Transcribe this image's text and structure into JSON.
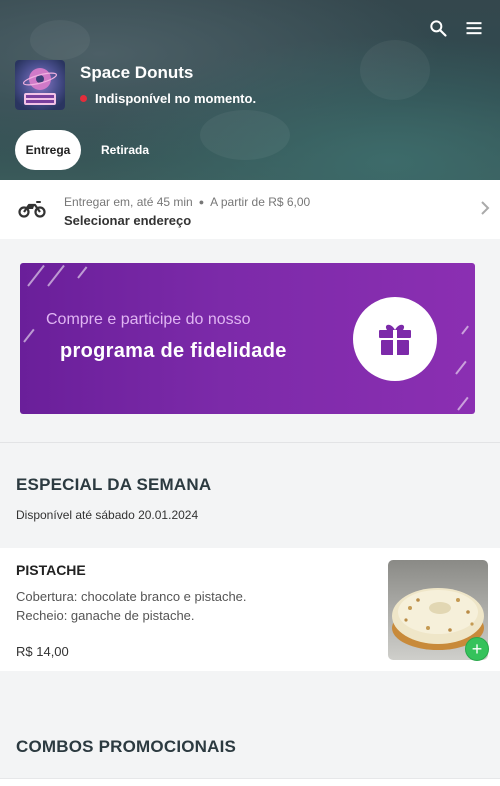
{
  "header": {
    "store_name": "Space Donuts",
    "status_text": "Indisponível no momento.",
    "status_color": "#e32d3b",
    "icons": [
      "search-icon",
      "menu-icon"
    ],
    "logo_text": "SPACE DONUTS",
    "tabs": [
      {
        "label": "Entrega",
        "active": true
      },
      {
        "label": "Retirada",
        "active": false
      }
    ]
  },
  "delivery": {
    "icon": "motorcycle-icon",
    "time_text": "Entregar em, até 45 min",
    "fee_text": "A partir de R$ 6,00",
    "address_label": "Selecionar endereço"
  },
  "banner": {
    "line1": "Compre e participe do nosso",
    "line2": "programa de fidelidade",
    "icon": "gift-icon",
    "accent_color": "#7c2aa9"
  },
  "sections": {
    "special": {
      "title": "ESPECIAL DA SEMANA",
      "subtitle": "Disponível até sábado 20.01.2024",
      "products": [
        {
          "name": "PISTACHE",
          "description_line1": "Cobertura: chocolate branco e pistache.",
          "description_line2": "Recheio: ganache de pistache.",
          "price": "R$ 14,00",
          "add_label": "+"
        }
      ]
    },
    "combos": {
      "title": "COMBOS PROMOCIONAIS"
    }
  },
  "colors": {
    "add_button": "#35c25b",
    "banner_purple": "#7c2aa9"
  }
}
